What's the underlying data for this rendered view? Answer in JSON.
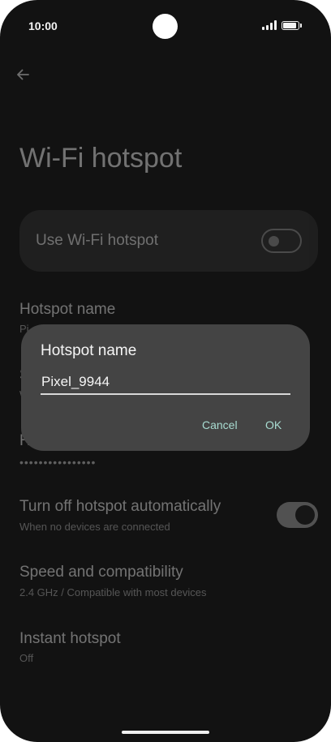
{
  "status_bar": {
    "time": "10:00"
  },
  "page": {
    "title": "Wi-Fi hotspot"
  },
  "master_switch": {
    "label": "Use Wi-Fi hotspot",
    "state": "off"
  },
  "settings": {
    "hotspot_name_title": "Hotspot name",
    "hotspot_name_sub_partial": "Pi",
    "hidden_item_partial": "S",
    "hidden_item_sub_partial": "W",
    "password_partial": "H",
    "password_dots": "••••••••••••••••",
    "auto_off_title": "Turn off hotspot automatically",
    "auto_off_sub": "When no devices are connected",
    "auto_off_state": "on",
    "speed_title": "Speed and compatibility",
    "speed_sub": "2.4 GHz / Compatible with most devices",
    "instant_title": "Instant hotspot",
    "instant_sub": "Off"
  },
  "dialog": {
    "title": "Hotspot name",
    "input_value": "Pixel_9944",
    "cancel_label": "Cancel",
    "ok_label": "OK"
  },
  "colors": {
    "background": "#121212",
    "dialog": "#444444",
    "accent": "#a8dcd1"
  },
  "icons": {
    "back": "arrow-left-icon",
    "signal": "signal-icon",
    "battery": "battery-icon"
  }
}
